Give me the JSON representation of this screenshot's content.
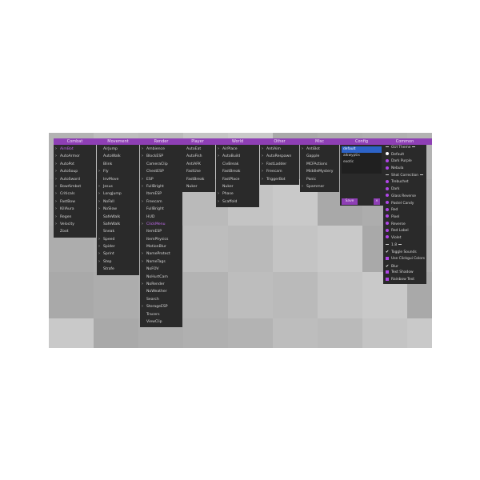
{
  "menus": [
    {
      "key": "combat",
      "title": "Combat",
      "items": [
        {
          "label": "AimBot",
          "arrow": true,
          "selected": true
        },
        {
          "label": "AutoArmor",
          "arrow": true
        },
        {
          "label": "AutoPot",
          "arrow": true
        },
        {
          "label": "AutoSoup",
          "arrow": true
        },
        {
          "label": "AutoSword",
          "arrow": true
        },
        {
          "label": "BowAimbot",
          "arrow": true
        },
        {
          "label": "Criticals",
          "arrow": true
        },
        {
          "label": "FastBow",
          "arrow": true
        },
        {
          "label": "KillAura",
          "arrow": true
        },
        {
          "label": "Regen",
          "arrow": true
        },
        {
          "label": "Velocity",
          "arrow": true
        },
        {
          "label": "Zoot",
          "arrow": false
        }
      ]
    },
    {
      "key": "movement",
      "title": "Movement",
      "items": [
        {
          "label": "AirJump",
          "arrow": false
        },
        {
          "label": "AutoWalk",
          "arrow": false
        },
        {
          "label": "Blink",
          "arrow": false
        },
        {
          "label": "Fly",
          "arrow": true
        },
        {
          "label": "InvMove",
          "arrow": false
        },
        {
          "label": "Jesus",
          "arrow": true
        },
        {
          "label": "LongJump",
          "arrow": true
        },
        {
          "label": "NoFall",
          "arrow": true
        },
        {
          "label": "NoSlow",
          "arrow": true
        },
        {
          "label": "SafeWalk",
          "arrow": false
        },
        {
          "label": "SafeWalk",
          "arrow": false
        },
        {
          "label": "Sneak",
          "arrow": false
        },
        {
          "label": "Speed",
          "arrow": true
        },
        {
          "label": "Spider",
          "arrow": true
        },
        {
          "label": "Sprint",
          "arrow": true
        },
        {
          "label": "Step",
          "arrow": true
        },
        {
          "label": "Strafe",
          "arrow": false
        }
      ]
    },
    {
      "key": "render",
      "title": "Render",
      "items": [
        {
          "label": "Ambience",
          "arrow": true
        },
        {
          "label": "BlockESP",
          "arrow": true
        },
        {
          "label": "CameraClip",
          "arrow": false
        },
        {
          "label": "ChestESP",
          "arrow": false
        },
        {
          "label": "ESP",
          "arrow": true
        },
        {
          "label": "FullBright",
          "arrow": true
        },
        {
          "label": "ItemESP",
          "arrow": false
        },
        {
          "label": "Freecam",
          "arrow": true
        },
        {
          "label": "FullBright",
          "arrow": false
        },
        {
          "label": "HUD",
          "arrow": false
        },
        {
          "label": "ClickMenu",
          "arrow": true,
          "selected": true
        },
        {
          "label": "ItemESP",
          "arrow": false
        },
        {
          "label": "ItemPhysics",
          "arrow": false
        },
        {
          "label": "MotionBlur",
          "arrow": false
        },
        {
          "label": "NameProtect",
          "arrow": true
        },
        {
          "label": "NameTags",
          "arrow": true
        },
        {
          "label": "NoFOV",
          "arrow": false
        },
        {
          "label": "NoHurtCam",
          "arrow": false
        },
        {
          "label": "NoRender",
          "arrow": true
        },
        {
          "label": "NoWeather",
          "arrow": false
        },
        {
          "label": "Search",
          "arrow": false
        },
        {
          "label": "StorageESP",
          "arrow": true
        },
        {
          "label": "Tracers",
          "arrow": false
        },
        {
          "label": "ViewClip",
          "arrow": false
        }
      ]
    },
    {
      "key": "player",
      "title": "Player",
      "items": [
        {
          "label": "AutoEat",
          "arrow": false
        },
        {
          "label": "AutoFish",
          "arrow": false
        },
        {
          "label": "AntiAFK",
          "arrow": false
        },
        {
          "label": "FastUse",
          "arrow": false
        },
        {
          "label": "FastBreak",
          "arrow": false
        },
        {
          "label": "Nuker",
          "arrow": false
        }
      ]
    },
    {
      "key": "world",
      "title": "World",
      "items": [
        {
          "label": "AirPlace",
          "arrow": true
        },
        {
          "label": "AutoBuild",
          "arrow": true
        },
        {
          "label": "CivBreak",
          "arrow": false
        },
        {
          "label": "FastBreak",
          "arrow": false
        },
        {
          "label": "FastPlace",
          "arrow": false
        },
        {
          "label": "Nuker",
          "arrow": false
        },
        {
          "label": "Phase",
          "arrow": true
        },
        {
          "label": "Scaffold",
          "arrow": true
        }
      ]
    },
    {
      "key": "other",
      "title": "Other",
      "items": [
        {
          "label": "AntiAim",
          "arrow": true
        },
        {
          "label": "AutoRespawn",
          "arrow": true
        },
        {
          "label": "FastLadder",
          "arrow": true
        },
        {
          "label": "Freecam",
          "arrow": true
        },
        {
          "label": "TriggerBot",
          "arrow": true
        }
      ]
    },
    {
      "key": "misc",
      "title": "Misc",
      "items": [
        {
          "label": "AntiBot",
          "arrow": true
        },
        {
          "label": "Gapple",
          "arrow": false
        },
        {
          "label": "MCFActions",
          "arrow": false
        },
        {
          "label": "MiddleMystery",
          "arrow": false
        },
        {
          "label": "Panic",
          "arrow": false
        },
        {
          "label": "Spammer",
          "arrow": true
        }
      ]
    }
  ],
  "config": {
    "title": "Config",
    "profiles": [
      "default",
      "aikwyptix",
      "exotic"
    ],
    "selected_index": 0,
    "save_button": "Save",
    "delete_button": "×"
  },
  "common": {
    "title": "Common",
    "items": [
      {
        "kind": "sep",
        "label": "GUI Theme"
      },
      {
        "kind": "radio",
        "on": true,
        "label": "Default"
      },
      {
        "kind": "radio",
        "on": false,
        "label": "Dark Purple"
      },
      {
        "kind": "radio",
        "on": false,
        "label": "Nebula"
      },
      {
        "kind": "sep",
        "label": "Shot Correction"
      },
      {
        "kind": "radio",
        "on": false,
        "label": "Trebuchet"
      },
      {
        "kind": "radio",
        "on": false,
        "label": "Dark"
      },
      {
        "kind": "radio",
        "on": false,
        "label": "Glass Reverse"
      },
      {
        "kind": "radio",
        "on": false,
        "label": "Pastel Candy"
      },
      {
        "kind": "radio",
        "on": false,
        "label": "Red"
      },
      {
        "kind": "radio",
        "on": false,
        "label": "Pixel"
      },
      {
        "kind": "radio",
        "on": false,
        "label": "Reverse"
      },
      {
        "kind": "radio",
        "on": false,
        "label": "Red Label"
      },
      {
        "kind": "radio",
        "on": false,
        "label": "Violet"
      },
      {
        "kind": "sep",
        "label": "1.8"
      },
      {
        "kind": "check",
        "on": true,
        "label": "Toggle Sounds"
      },
      {
        "kind": "box",
        "on": false,
        "label": "Use Clickgui Colors"
      },
      {
        "kind": "check",
        "on": true,
        "label": "Blur"
      },
      {
        "kind": "box",
        "on": false,
        "label": "Text Shadow"
      },
      {
        "kind": "box",
        "on": false,
        "label": "Rainbow Text"
      }
    ]
  }
}
